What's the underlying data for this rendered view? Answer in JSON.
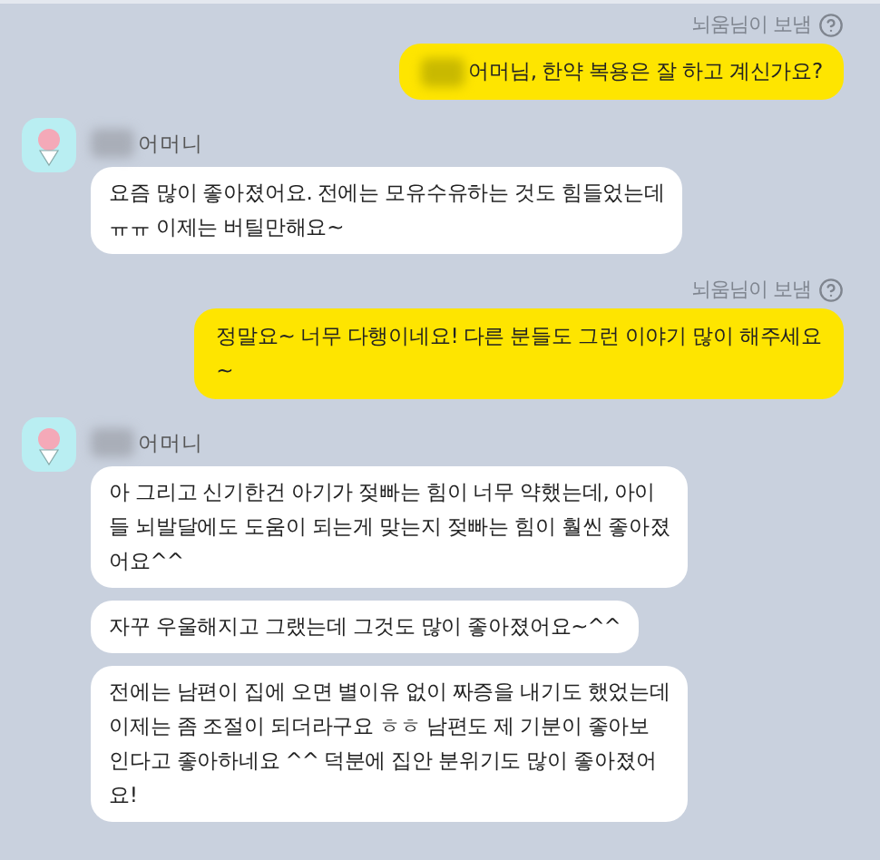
{
  "messages": [
    {
      "kind": "sent",
      "status": "뇌움님이 보냄",
      "redacted_prefix": true,
      "text": "어머님, 한약 복용은 잘 하고 계신가요?"
    },
    {
      "kind": "received",
      "sender": "어머니",
      "sender_redacted": true,
      "bubbles": [
        "요즘 많이 좋아졌어요. 전에는 모유수유하는 것도 힘들었는데\nㅠㅠ 이제는 버틸만해요~"
      ]
    },
    {
      "kind": "sent",
      "status": "뇌움님이 보냄",
      "text": "정말요~ 너무 다행이네요! 다른 분들도 그런 이야기 많이 해주세요\n~"
    },
    {
      "kind": "received",
      "sender": "어머니",
      "sender_redacted": true,
      "bubbles": [
        "아 그리고 신기한건 아기가 젖빠는 힘이 너무 약했는데, 아이\n들 뇌발달에도 도움이 되는게 맞는지 젖빠는 힘이 훨씬 좋아졌\n어요^^",
        "자꾸 우울해지고 그랬는데 그것도 많이 좋아졌어요~^^",
        "전에는 남편이 집에 오면 별이유 없이 짜증을 내기도 했었는데\n이제는 좀 조절이 되더라구요 ㅎㅎ 남편도 제 기분이 좋아보\n인다고 좋아하네요 ^^ 덕분에 집안 분위기도 많이 좋아졌어\n요!"
      ]
    }
  ]
}
